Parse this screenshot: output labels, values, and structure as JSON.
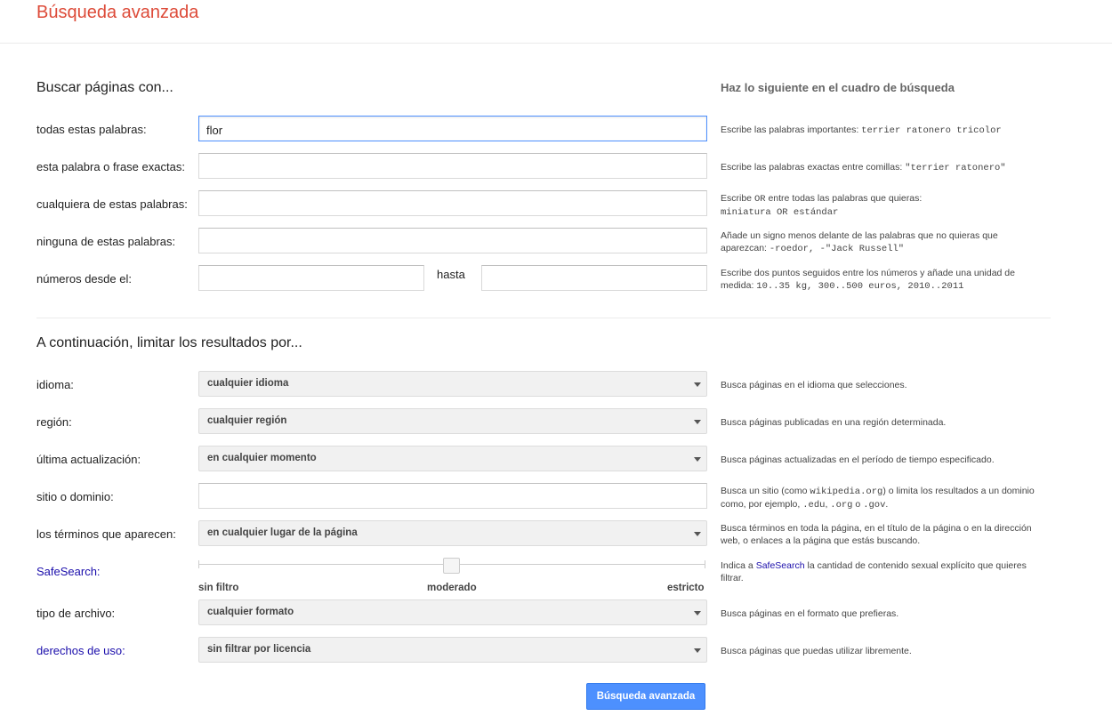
{
  "page": {
    "title": "Búsqueda avanzada"
  },
  "find": {
    "heading": "Buscar páginas con...",
    "right_heading": "Haz lo siguiente en el cuadro de búsqueda",
    "rows": [
      {
        "label": "todas estas palabras:",
        "value": "flor",
        "help_prefix": "Escribe las palabras importantes: ",
        "help_code": "terrier ratonero tricolor"
      },
      {
        "label": "esta palabra o frase exactas:",
        "value": "",
        "help_prefix": "Escribe las palabras exactas entre comillas: ",
        "help_code": "\"terrier ratonero\""
      },
      {
        "label": "cualquiera de estas palabras:",
        "value": "",
        "help_prefix": "Escribe ",
        "help_or": "OR",
        "help_suffix": " entre todas las palabras que quieras:",
        "help_code": "miniatura OR estándar"
      },
      {
        "label": "ninguna de estas palabras:",
        "value": "",
        "help_prefix": "Añade un signo menos delante de las palabras que no quieras que aparezcan: ",
        "help_code": "-roedor, -\"Jack Russell\""
      },
      {
        "label": "números desde el:",
        "value_from": "",
        "to_label": "hasta",
        "value_to": "",
        "help_prefix": "Escribe dos puntos seguidos entre los números y añade una unidad de medida: ",
        "help_code": "10..35 kg, 300..500 euros, 2010..2011"
      }
    ]
  },
  "narrow": {
    "heading": "A continuación, limitar los resultados por...",
    "language": {
      "label": "idioma:",
      "value": "cualquier idioma",
      "help": "Busca páginas en el idioma que selecciones."
    },
    "region": {
      "label": "región:",
      "value": "cualquier región",
      "help": "Busca páginas publicadas en una región determinada."
    },
    "last_update": {
      "label": "última actualización:",
      "value": "en cualquier momento",
      "help": "Busca páginas actualizadas en el período de tiempo especificado."
    },
    "site": {
      "label": "sitio o dominio:",
      "value": "",
      "help_a": "Busca un sitio (como ",
      "help_code1": "wikipedia.org",
      "help_b": ") o limita los resultados a un dominio como, por ejemplo, ",
      "help_code2": ".edu",
      "help_c": ", ",
      "help_code3": ".org",
      "help_d": " o ",
      "help_code4": ".gov",
      "help_e": "."
    },
    "terms": {
      "label": "los términos que aparecen:",
      "value": "en cualquier lugar de la página",
      "help": "Busca términos en toda la página, en el título de la página o en la dirección web, o enlaces a la página que estás buscando."
    },
    "safesearch": {
      "label": "SafeSearch:",
      "level": 0.5,
      "labels": [
        "sin filtro",
        "moderado",
        "estricto"
      ],
      "help_a": "Indica a ",
      "help_link": "SafeSearch",
      "help_b": " la cantidad de contenido sexual explícito que quieres filtrar."
    },
    "file_type": {
      "label": "tipo de archivo:",
      "value": "cualquier formato",
      "help": "Busca páginas en el formato que prefieras."
    },
    "usage_rights": {
      "label": "derechos de uso:",
      "value": "sin filtrar por licencia",
      "help": "Busca páginas que puedas utilizar libremente."
    }
  },
  "submit": {
    "label": "Búsqueda avanzada"
  },
  "colors": {
    "title": "#dd4b39",
    "link": "#1a0dab",
    "button": "#4d90fe",
    "focus": "#4d90fe"
  }
}
